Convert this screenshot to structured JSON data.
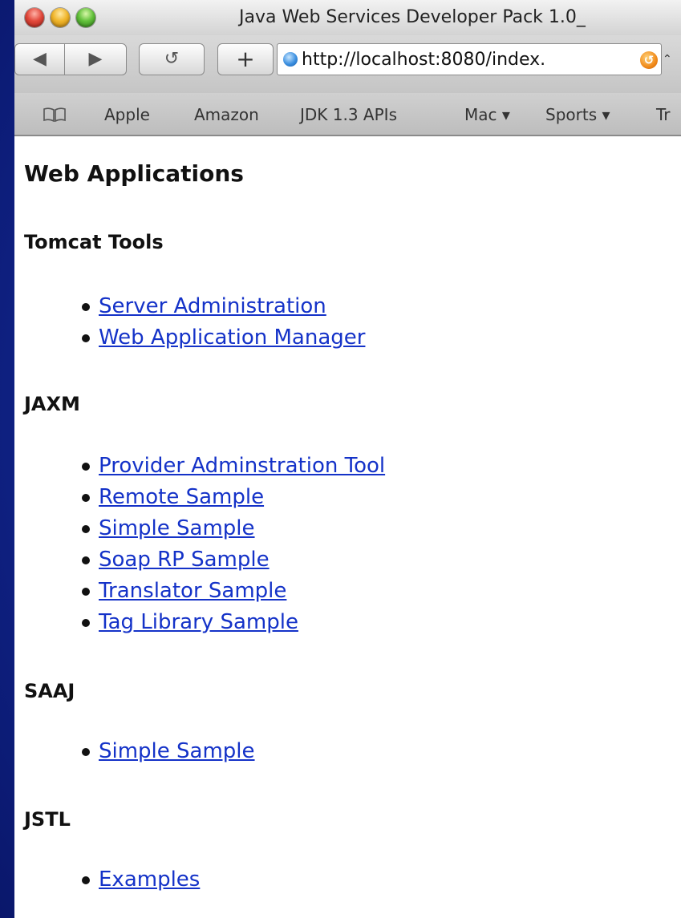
{
  "window": {
    "title": "Java Web Services Developer Pack 1.0_"
  },
  "toolbar": {
    "back_label": "◀",
    "forward_label": "▶",
    "reload_label": "↺",
    "add_label": "+",
    "url": "http://localhost:8080/index."
  },
  "bookmarks": [
    "Apple",
    "Amazon",
    "JDK 1.3 APIs",
    "Mac ▾",
    "Sports ▾",
    "Tr"
  ],
  "page": {
    "title": "Web Applications",
    "sections": [
      {
        "heading": "Tomcat Tools",
        "links": [
          "Server Administration",
          "Web Application Manager"
        ]
      },
      {
        "heading": "JAXM",
        "links": [
          "Provider Adminstration Tool",
          "Remote Sample",
          "Simple Sample",
          "Soap RP Sample",
          "Translator Sample",
          "Tag Library Sample"
        ]
      },
      {
        "heading": "SAAJ",
        "links": [
          "Simple Sample"
        ]
      },
      {
        "heading": "JSTL",
        "links": [
          "Examples"
        ]
      }
    ]
  },
  "colors": {
    "link": "#1432c8",
    "desktop": "#10248a"
  }
}
